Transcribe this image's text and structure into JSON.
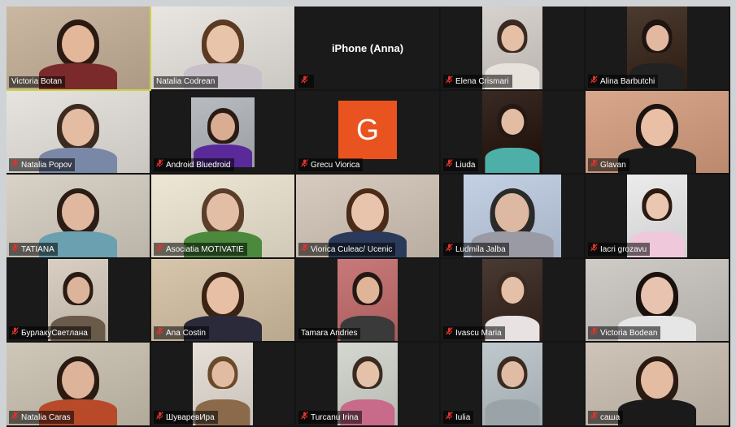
{
  "meeting": {
    "participants": [
      {
        "name": "Victoria Botan",
        "muted": false,
        "active": true,
        "tile": "full",
        "bg": "#cbb8a2",
        "hair": "#2a1a12",
        "skin": "#e3b79a",
        "cloth": "#7a2a2a"
      },
      {
        "name": "Natalia Codrean",
        "muted": false,
        "active": false,
        "tile": "full",
        "bg": "#e9e6e1",
        "hair": "#5a3a22",
        "skin": "#e8c4aa",
        "cloth": "#c8c0c8"
      },
      {
        "name": "iPhone (Anna)",
        "muted": true,
        "active": false,
        "tile": "text",
        "label_only": "",
        "center": "iPhone (Anna)"
      },
      {
        "name": "Elena Crismari",
        "muted": true,
        "active": false,
        "tile": "center",
        "bg": "#d7d2cd",
        "hair": "#3a2a22",
        "skin": "#e6c0a6",
        "cloth": "#e8e2dc"
      },
      {
        "name": "Alina Barbutchi",
        "muted": true,
        "active": false,
        "tile": "center",
        "bg": "#4a3a30",
        "hair": "#1e1410",
        "skin": "#e2b8a0",
        "cloth": "#222222"
      },
      {
        "name": "Natalia Popov",
        "muted": true,
        "active": false,
        "tile": "full",
        "bg": "#e7e3de",
        "hair": "#3b2a20",
        "skin": "#e4bca2",
        "cloth": "#7a88a8"
      },
      {
        "name": "Android Bluedroid",
        "muted": true,
        "active": false,
        "tile": "small",
        "bg": "#b8bcc0",
        "hair": "#2b1a14",
        "skin": "#d9ad92",
        "cloth": "#5a2a9a"
      },
      {
        "name": "Grecu Viorica",
        "muted": true,
        "active": false,
        "tile": "avatar",
        "avatar": "G"
      },
      {
        "name": "Liuda",
        "muted": true,
        "active": false,
        "tile": "center",
        "bg": "#3a2a24",
        "hair": "#241814",
        "skin": "#e3bca4",
        "cloth": "#4db0a8"
      },
      {
        "name": "Glavan",
        "muted": true,
        "active": false,
        "tile": "full",
        "bg": "#d8a78c",
        "hair": "#1c120e",
        "skin": "#e9bfa6",
        "cloth": "#1a1a1a"
      },
      {
        "name": "TATIANA",
        "muted": true,
        "active": false,
        "tile": "full",
        "bg": "#d9d2c7",
        "hair": "#2b1c14",
        "skin": "#e0b8a0",
        "cloth": "#6aa0b0"
      },
      {
        "name": "Asociatia MOTIVATIE",
        "muted": true,
        "active": false,
        "tile": "full",
        "bg": "#efe7d5",
        "hair": "#5a3e2a",
        "skin": "#e3bea6",
        "cloth": "#4b8a3c"
      },
      {
        "name": "Viorica Culeac/ Ucenic",
        "muted": true,
        "active": false,
        "tile": "full",
        "bg": "#d7cbbf",
        "hair": "#4a2a18",
        "skin": "#e9c4ac",
        "cloth": "#2a3a5a"
      },
      {
        "name": "Ludmila Jalba",
        "muted": true,
        "active": false,
        "tile": "wide",
        "bg": "#c4d1e4",
        "hair": "#2a2a2a",
        "skin": "#ddb8a2",
        "cloth": "#9a9aa4"
      },
      {
        "name": "Iacri grozavu",
        "muted": true,
        "active": false,
        "tile": "center",
        "bg": "#ececec",
        "hair": "#2a1a12",
        "skin": "#ebc6b0",
        "cloth": "#f0c8dc"
      },
      {
        "name": "БурлакуСветлана",
        "muted": true,
        "active": false,
        "tile": "center",
        "bg": "#d9cfc2",
        "hair": "#2a1a14",
        "skin": "#dcb49c",
        "cloth": "#6a5a4a"
      },
      {
        "name": "Ana Costin",
        "muted": true,
        "active": false,
        "tile": "full",
        "bg": "#d8c6ac",
        "hair": "#3a2214",
        "skin": "#e6bfa4",
        "cloth": "#2a2a3a"
      },
      {
        "name": "Tamara Andries",
        "muted": false,
        "active": false,
        "tile": "center",
        "bg": "#c87a7a",
        "hair": "#241814",
        "skin": "#e0b498",
        "cloth": "#3a3a3a"
      },
      {
        "name": "Ivascu Maria",
        "muted": true,
        "active": false,
        "tile": "center",
        "bg": "#4a3a34",
        "hair": "#3a2a20",
        "skin": "#e4c0a8",
        "cloth": "#e8e2e2"
      },
      {
        "name": "Victoria Bodean",
        "muted": true,
        "active": false,
        "tile": "full",
        "bg": "#cfcbc6",
        "hair": "#1a100c",
        "skin": "#e8c4b0",
        "cloth": "#e6e6e6"
      },
      {
        "name": "Natalia Caras",
        "muted": true,
        "active": false,
        "tile": "full",
        "bg": "#cfc7b8",
        "hair": "#2a1a12",
        "skin": "#ddb49a",
        "cloth": "#b84a2a"
      },
      {
        "name": "ШуваревИра",
        "muted": true,
        "active": false,
        "tile": "center",
        "bg": "#e6e0d8",
        "hair": "#6a4a2a",
        "skin": "#e2bca2",
        "cloth": "#8a6a4a"
      },
      {
        "name": "Turcanu Irina",
        "muted": true,
        "active": false,
        "tile": "center",
        "bg": "#d4d8d0",
        "hair": "#3a2a20",
        "skin": "#e4c2aa",
        "cloth": "#c86a8a"
      },
      {
        "name": "Iulia",
        "muted": true,
        "active": false,
        "tile": "center",
        "bg": "#bfc8cc",
        "hair": "#3a2a22",
        "skin": "#e0bca4",
        "cloth": "#9aa4a8"
      },
      {
        "name": "саша",
        "muted": true,
        "active": false,
        "tile": "full",
        "bg": "#cfc4b8",
        "hair": "#2a1a12",
        "skin": "#e3bca2",
        "cloth": "#1a1a1a"
      }
    ]
  },
  "colors": {
    "active_border": "#c9d34a",
    "muted_icon": "#e0332c",
    "grid_bg": "#1a1a1a",
    "avatar_bg": "#e8531f"
  }
}
